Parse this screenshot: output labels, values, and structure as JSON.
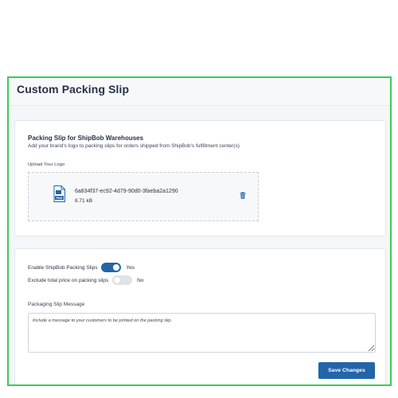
{
  "page": {
    "title": "Custom Packing Slip"
  },
  "branding": {
    "section_title": "Packing Slip for ShipBob Warehouses",
    "section_description": "Add your brand's logo to packing slips for orders shipped from ShipBob's fulfillment center(s)",
    "upload_label": "Upload Your Logo",
    "file": {
      "name": "6a834f37-ec92-4d79-90d0-3faeba2a1290",
      "size": "8.71 kB",
      "type_badge": "PNG",
      "icon": "png-file-icon"
    },
    "delete_icon": "trash-icon"
  },
  "settings": {
    "enable_packing_slips": {
      "label": "Enable ShipBob Packing Slips",
      "enabled": true,
      "state_text": "Yes"
    },
    "exclude_total_price": {
      "label": "Exclude total price on packing slips",
      "enabled": false,
      "state_text": "No"
    },
    "message_label": "Packaging Slip Message",
    "message_value": "",
    "message_placeholder": "Include a message to your customers to be printed on the packing slip.",
    "save_label": "Save Changes"
  },
  "colors": {
    "accent": "#2265a8",
    "frame_highlight": "#3ec95a",
    "title_text": "#25304a"
  }
}
